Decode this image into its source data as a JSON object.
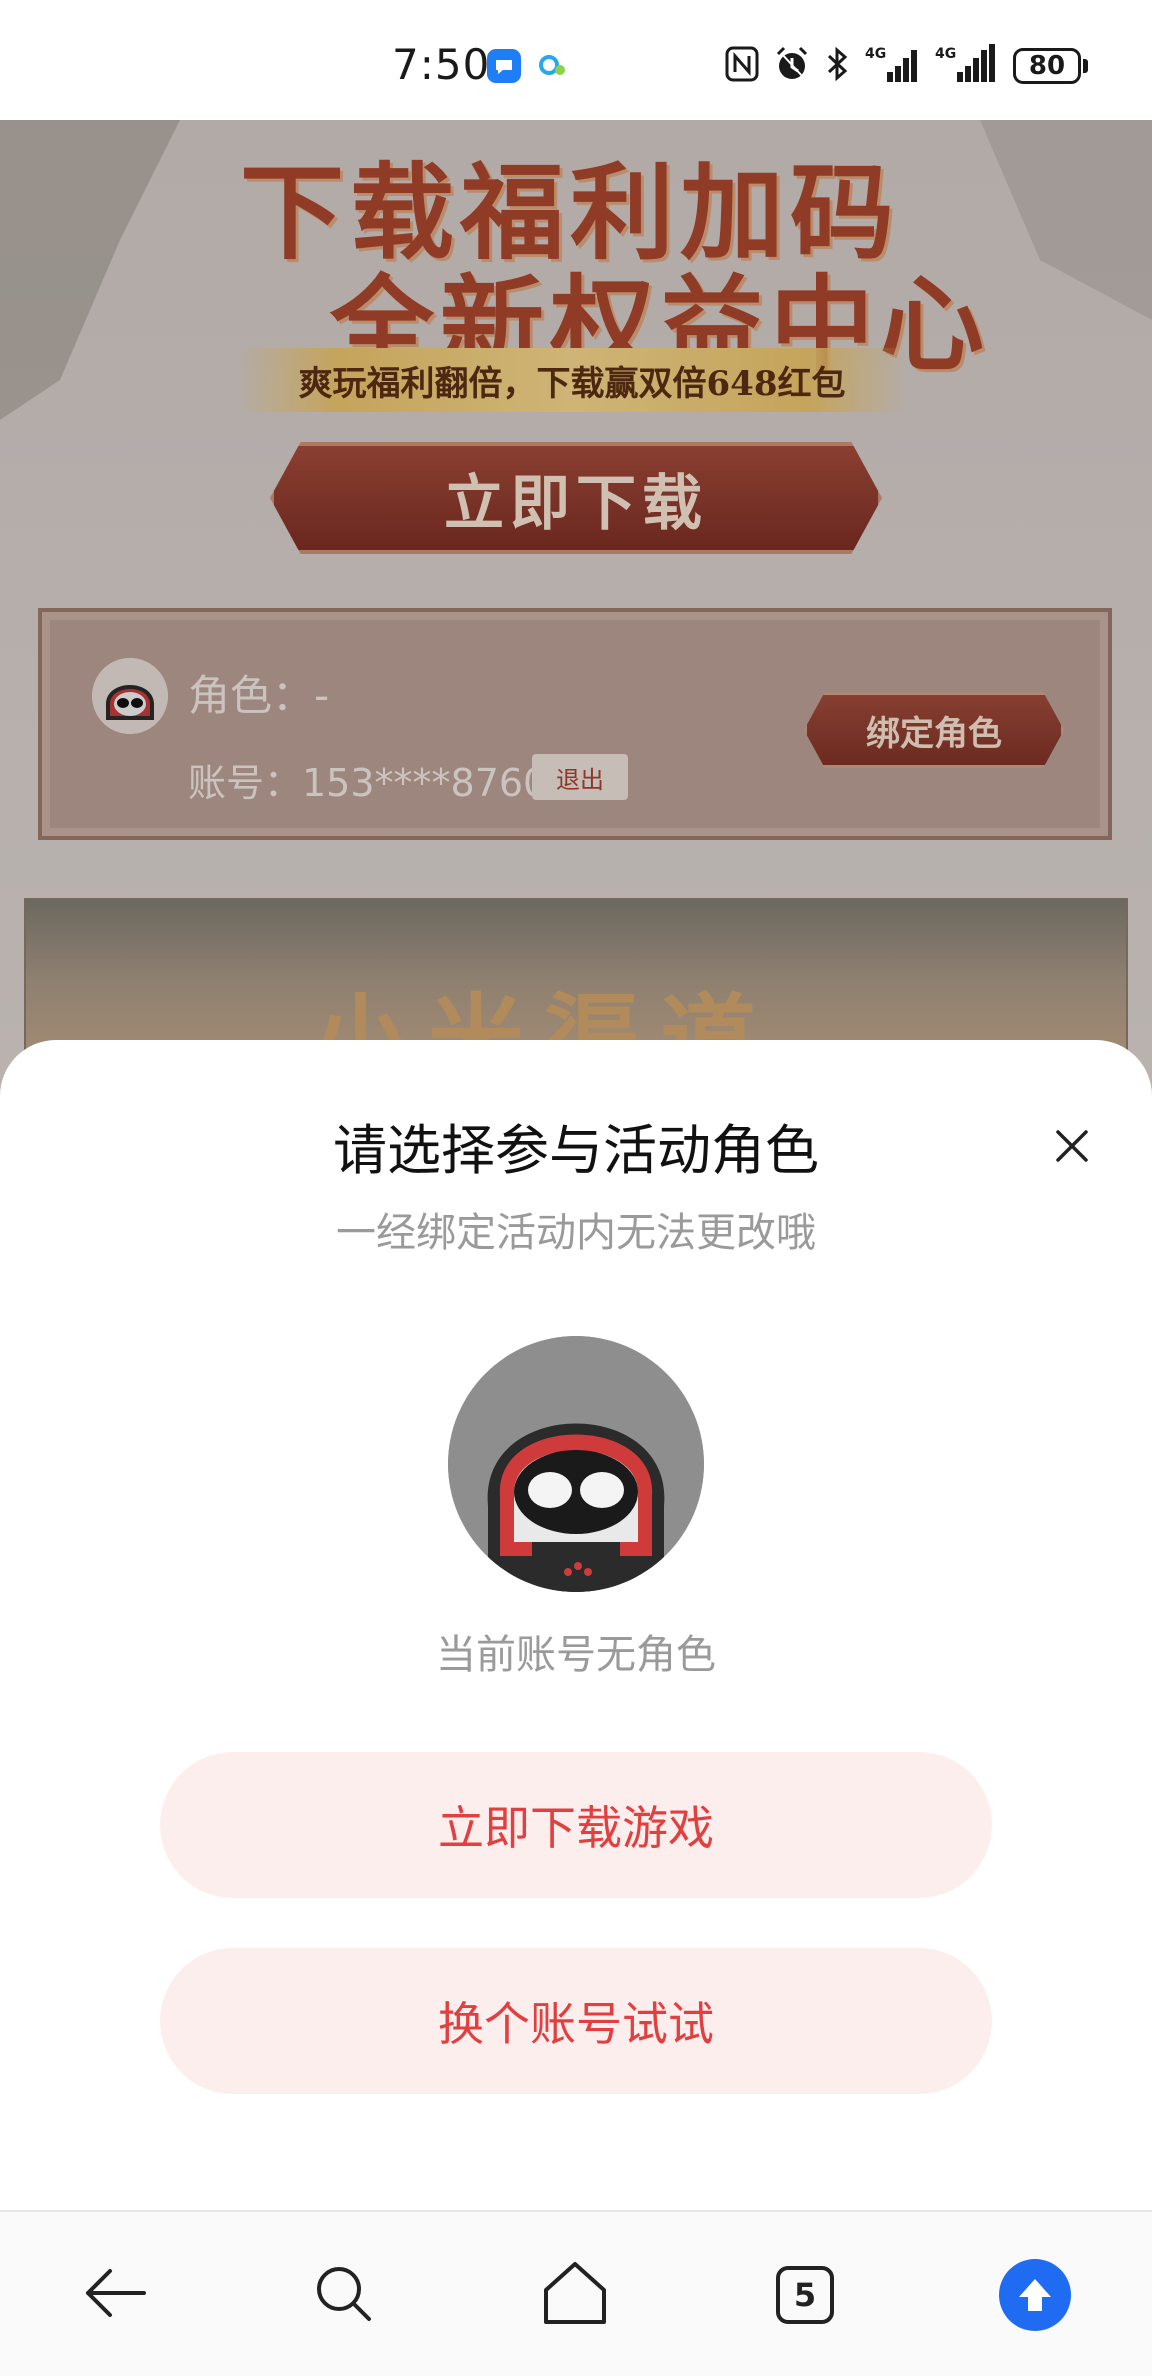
{
  "status_bar": {
    "time": "7:50",
    "icons": [
      "chat-notification-icon",
      "qq-cloud-icon",
      "nfc-icon",
      "alarm-icon",
      "bluetooth-icon",
      "signal-4g-icon",
      "signal-4g-icon"
    ],
    "battery": "80"
  },
  "background_page": {
    "hero_title_line1": "下载福利加码",
    "hero_title_line2": "全新权益中心",
    "hero_ribbon": "爽玩福利翻倍，下载赢双倍648红包",
    "hero_download_button": "立即下载",
    "role_card": {
      "role_label": "角色：-",
      "account_label": "账号：153****8760",
      "logout_button": "退出",
      "bind_button": "绑定角色"
    },
    "banner_text": "小米渠道"
  },
  "sheet": {
    "title": "请选择参与活动角色",
    "subtitle": "一经绑定活动内无法更改哦",
    "no_role_text": "当前账号无角色",
    "download_game_button": "立即下载游戏",
    "switch_account_button": "换个账号试试"
  },
  "nav_bar": {
    "tab_count": "5",
    "accent_color": "#1f6bf2"
  },
  "colors": {
    "action_text": "#e0403f",
    "action_bg": "#fdeeee"
  }
}
